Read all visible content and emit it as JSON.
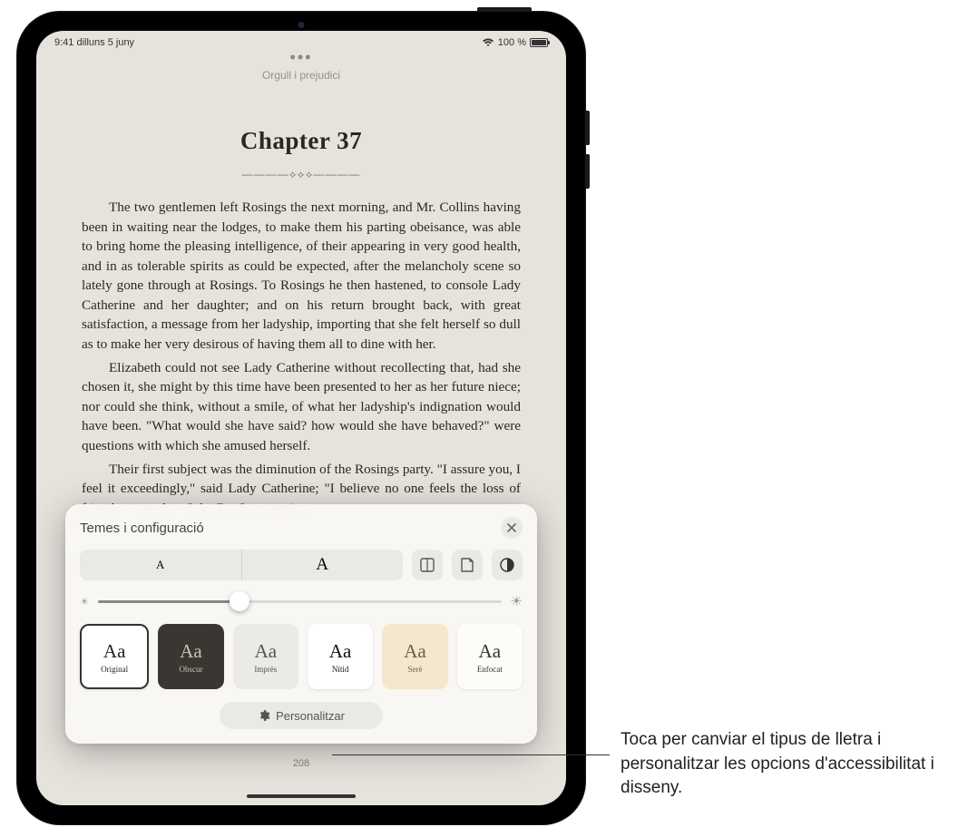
{
  "status": {
    "time_date": "9:41  dilluns 5 juny",
    "battery_percent": "100 %"
  },
  "book": {
    "title": "Orgull i prejudici",
    "chapter_heading": "Chapter 37",
    "page_number": "208",
    "paragraphs": [
      "The two gentlemen left Rosings the next morning, and Mr. Collins having been in waiting near the lodges, to make them his parting obeisance, was able to bring home the pleasing intelli­gence, of their appearing in very good health, and in as tolerable spirits as could be expected, after the melancholy scene so lately gone through at Rosings. To Rosings he then hastened, to console Lady Catherine and her daughter; and on his return brought back, with great satisfaction, a message from her ladyship, importing that she felt herself so dull as to make her very desirous of having them all to dine with her.",
      "Elizabeth could not see Lady Catherine without recollecting that, had she chosen it, she might by this time have been pre­sented to her as her future niece; nor could she think, without a smile, of what her ladyship's indignation would have been. \"What would she have said? how would she have behaved?\" were ques­tions with which she amused herself.",
      "Their first subject was the diminution of the Rosings party. \"I assure you, I feel it exceedingly,\" said Lady Catherine; \"I believe no one feels the loss of friends so much as I do. But I am particu-"
    ]
  },
  "panel": {
    "title": "Temes i configuració",
    "font_small_glyph": "A",
    "font_large_glyph": "A",
    "themes": [
      {
        "aa": "Aa",
        "label": "Original"
      },
      {
        "aa": "Aa",
        "label": "Obscur"
      },
      {
        "aa": "Aa",
        "label": "Imprès"
      },
      {
        "aa": "Aa",
        "label": "Nítid"
      },
      {
        "aa": "Aa",
        "label": "Serè"
      },
      {
        "aa": "Aa",
        "label": "Enfocat"
      }
    ],
    "customize_label": "Personalitzar",
    "brightness_value": 35
  },
  "callout": {
    "text": "Toca per canviar el tipus de lletra i personalitzar les opcions d'accessibilitat i disseny."
  }
}
